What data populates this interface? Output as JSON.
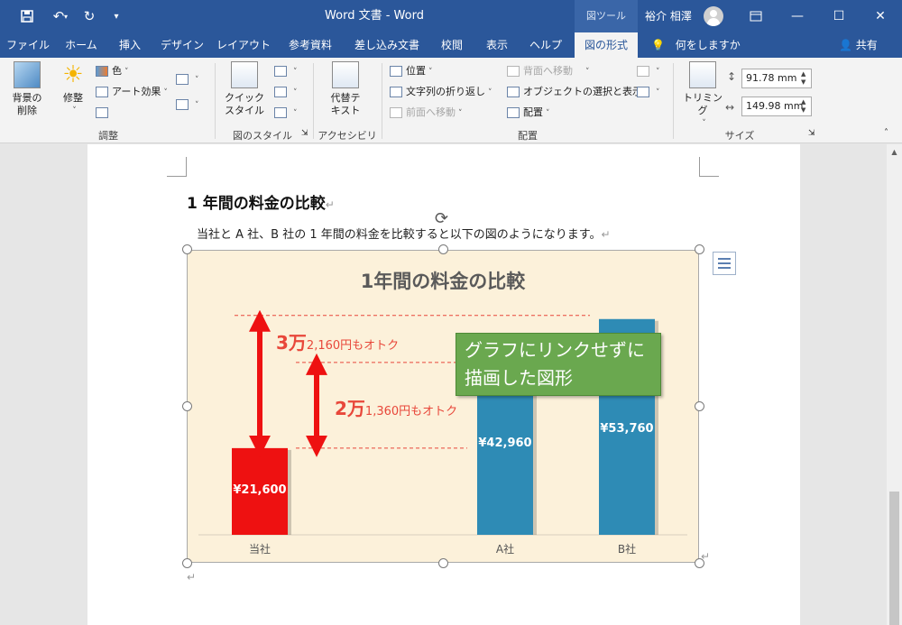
{
  "titlebar": {
    "doc_title": "Word 文書  -  Word",
    "picture_tools": "図ツール",
    "user_name": "裕介 相澤"
  },
  "tabs": [
    "ファイル",
    "ホーム",
    "挿入",
    "デザイン",
    "レイアウト",
    "参考資料",
    "差し込み文書",
    "校閲",
    "表示",
    "ヘルプ",
    "図の形式"
  ],
  "active_tab": "図の形式",
  "tell_me": "何をしますか",
  "share": "共有",
  "ribbon": {
    "remove_bg": [
      "背景の",
      "削除"
    ],
    "corrections": "修整",
    "color": "色",
    "artistic": "アート効果",
    "group_adjust": "調整",
    "quick_styles": [
      "クイック",
      "スタイル"
    ],
    "group_styles": "図のスタイル",
    "alt_text": [
      "代替テ",
      "キスト"
    ],
    "group_access": "アクセシビリティ",
    "position": "位置",
    "wrap_text": "文字列の折り返し",
    "bring_forward": "前面へ移動",
    "send_backward": "背面へ移動",
    "selection_pane": "オブジェクトの選択と表示",
    "align": "配置",
    "group_arrange": "配置",
    "crop": "トリミング",
    "height": "91.78 mm",
    "width": "149.98 mm",
    "group_size": "サイズ"
  },
  "document": {
    "heading": "1 年間の料金の比較",
    "paragraph": "当社と A 社、B 社の 1 年間の料金を比較すると以下の図のようになります。"
  },
  "chart_data": {
    "type": "bar",
    "title": "1年間の料金の比較",
    "categories": [
      "当社",
      "A社",
      "B社"
    ],
    "values": [
      21600,
      42960,
      53760
    ],
    "value_labels": [
      "¥21,600",
      "¥42,960",
      "¥53,760"
    ],
    "colors": [
      "#ee1111",
      "#2e8bb5",
      "#2e8bb5"
    ],
    "ylim": [
      0,
      60000
    ],
    "annotations": [
      {
        "big": "3万",
        "small": "2,160円もオトク"
      },
      {
        "big": "2万",
        "small": "1,360円もオトク"
      }
    ],
    "callout": [
      "グラフにリンクせずに",
      "描画した図形"
    ]
  }
}
